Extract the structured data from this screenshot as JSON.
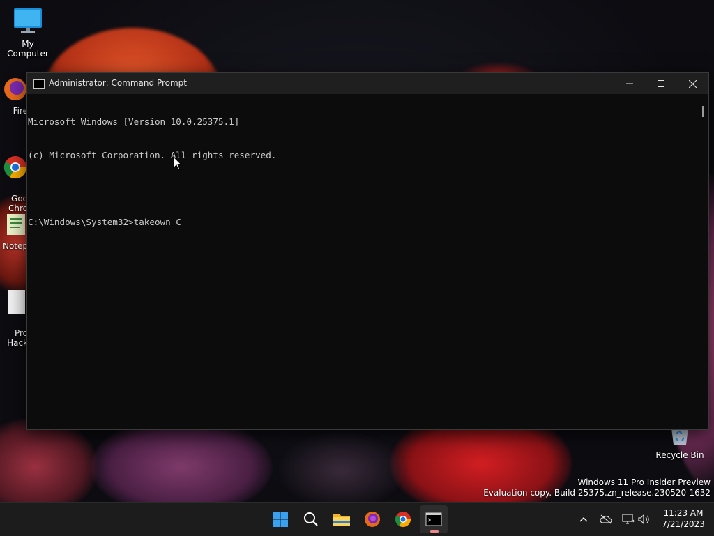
{
  "desktop": {
    "icons": [
      {
        "label": "My Computer"
      },
      {
        "label": "Fire"
      },
      {
        "label": "Goo\nChro"
      },
      {
        "label": "Notep"
      },
      {
        "label": "Pro\nHack"
      },
      {
        "label": "Recycle Bin"
      }
    ],
    "watermark": {
      "line1": "Windows 11 Pro Insider Preview",
      "line2": "Evaluation copy. Build 25375.zn_release.230520-1632"
    }
  },
  "window": {
    "title": "Administrator: Command Prompt",
    "console_lines": [
      "Microsoft Windows [Version 10.0.25375.1]",
      "(c) Microsoft Corporation. All rights reserved.",
      "",
      "C:\\Windows\\System32>takeown C"
    ]
  },
  "taskbar": {
    "apps": [
      {
        "name": "start"
      },
      {
        "name": "search"
      },
      {
        "name": "file-explorer"
      },
      {
        "name": "firefox"
      },
      {
        "name": "chrome"
      },
      {
        "name": "command-prompt",
        "active": true
      }
    ],
    "clock": {
      "time": "11:23 AM",
      "date": "7/21/2023"
    }
  },
  "colors": {
    "console_bg": "#0c0c0c",
    "console_text": "#cccccc",
    "titlebar": "#1f1f1f",
    "taskbar": "#1c1c1c"
  }
}
